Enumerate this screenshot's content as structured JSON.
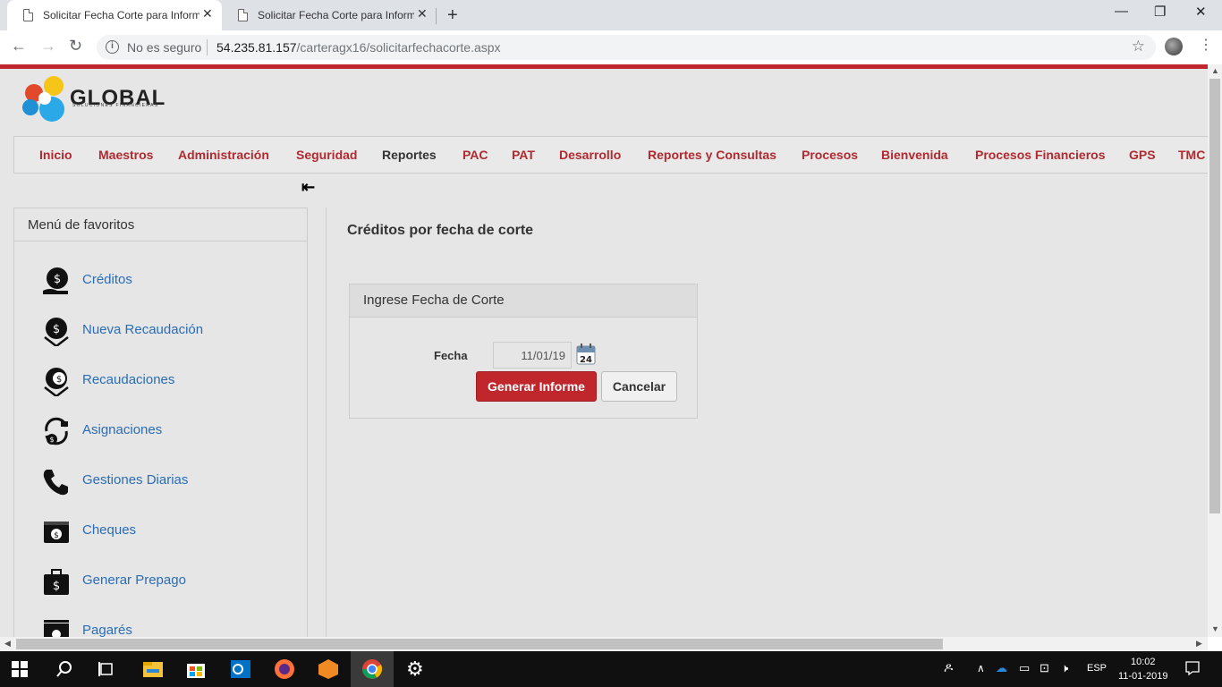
{
  "browser": {
    "tabs": [
      {
        "title": "Solicitar Fecha Corte para Inform",
        "close": "✕"
      },
      {
        "title": "Solicitar Fecha Corte para Inform",
        "close": "✕"
      }
    ],
    "new_tab": "+",
    "window_controls": {
      "minimize": "—",
      "restore": "❐",
      "close": "✕"
    },
    "security_label": "No es seguro",
    "url_host": "54.235.81.157",
    "url_path": "/carteragx16/solicitarfechacorte.aspx"
  },
  "logo": {
    "name": "GLOBAL",
    "tagline": "SOLUCIONES FINANCIERAS"
  },
  "nav": {
    "items": [
      "Inicio",
      "Maestros",
      "Administración",
      "Seguridad",
      "Reportes",
      "PAC",
      "PAT",
      "Desarrollo",
      "Reportes y Consultas",
      "Procesos",
      "Bienvenida",
      "Procesos Financieros",
      "GPS",
      "TMC"
    ],
    "active": "Reportes"
  },
  "favorites": {
    "title": "Menú de favoritos",
    "items": [
      {
        "label": "Créditos",
        "icon": "money-bag-icon"
      },
      {
        "label": "Nueva Recaudación",
        "icon": "money-download-icon"
      },
      {
        "label": "Recaudaciones",
        "icon": "money-collect-icon"
      },
      {
        "label": "Asignaciones",
        "icon": "money-cycle-icon"
      },
      {
        "label": "Gestiones Diarias",
        "icon": "phone-icon"
      },
      {
        "label": "Cheques",
        "icon": "cheque-icon"
      },
      {
        "label": "Generar Prepago",
        "icon": "briefcase-money-icon"
      },
      {
        "label": "Pagarés",
        "icon": "bills-icon"
      }
    ]
  },
  "main": {
    "title": "Créditos por fecha de corte",
    "card_title": "Ingrese Fecha de Corte",
    "fecha_label": "Fecha",
    "fecha_value": "11/01/19",
    "calendar_day": "24",
    "generate_label": "Generar Informe",
    "cancel_label": "Cancelar"
  },
  "taskbar": {
    "language": "ESP",
    "time": "10:02",
    "date": "11-01-2019"
  },
  "colors": {
    "accent": "#c0272d",
    "link": "#2a6db5",
    "page_bg": "#e6e6e6"
  }
}
